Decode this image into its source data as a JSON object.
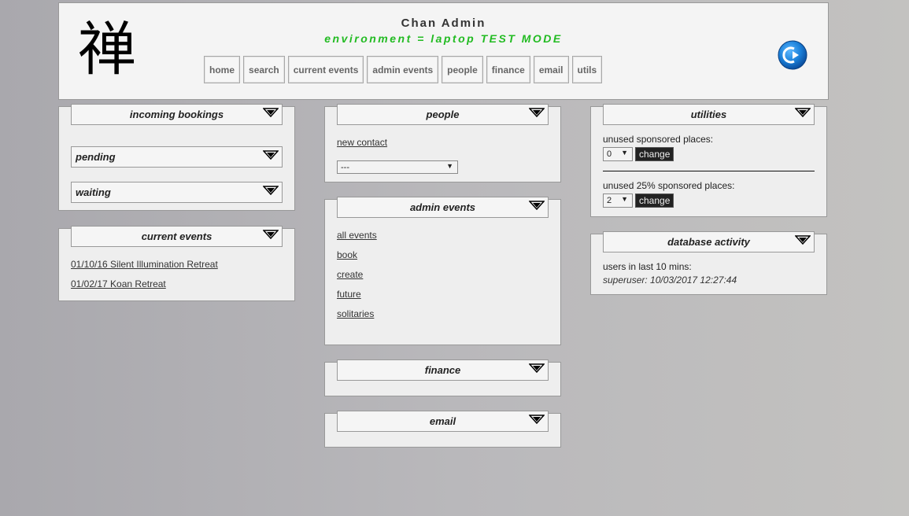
{
  "header": {
    "logo_glyph": "禅",
    "title": "Chan Admin",
    "environment": "environment = laptop TEST MODE",
    "nav": [
      "home",
      "search",
      "current events",
      "admin events",
      "people",
      "finance",
      "email",
      "utils"
    ],
    "logout_icon": "logout-arrow-icon"
  },
  "incoming_bookings": {
    "title": "incoming bookings",
    "pending": "pending",
    "waiting": "waiting"
  },
  "current_events": {
    "title": "current events",
    "items": [
      "01/10/16 Silent Illumination Retreat",
      "01/02/17 Koan Retreat"
    ]
  },
  "people": {
    "title": "people",
    "new_contact": "new contact",
    "select_value": "---"
  },
  "admin_events": {
    "title": "admin events",
    "links": [
      "all events",
      "book",
      "create",
      "future",
      "solitaries"
    ]
  },
  "finance": {
    "title": "finance"
  },
  "email": {
    "title": "email"
  },
  "utilities": {
    "title": "utilities",
    "unused_label": "unused sponsored places:",
    "unused_value": "0",
    "unused25_label": "unused 25% sponsored places:",
    "unused25_value": "2",
    "change_label": "change"
  },
  "database_activity": {
    "title": "database activity",
    "users_label": "users in last 10 mins:",
    "entry": "superuser: 10/03/2017 12:27:44"
  },
  "colors": {
    "env_green": "#22bb22",
    "logout_blue": "#1a7fd8"
  }
}
